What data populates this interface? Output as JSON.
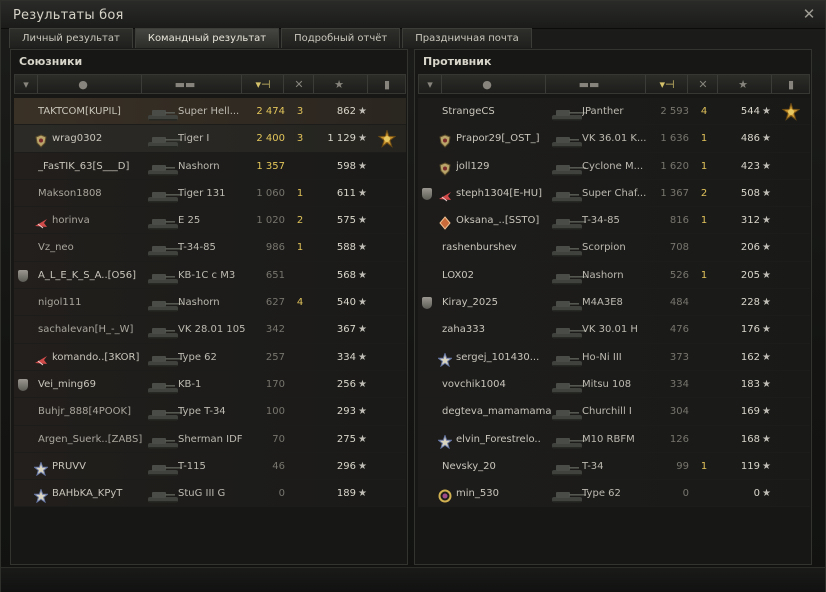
{
  "window": {
    "title": "Результаты боя"
  },
  "tabs": [
    {
      "label": "Личный результат"
    },
    {
      "label": "Командный результат"
    },
    {
      "label": "Подробный отчёт"
    },
    {
      "label": "Праздничная почта"
    }
  ],
  "allies": {
    "title": "Союзники",
    "rows": [
      {
        "name": "TAKTCOM[KUPIL]",
        "vehicle": "Super Hell...",
        "damage": "2 474",
        "kills": "3",
        "xp": "862"
      },
      {
        "name": "wrag0302",
        "vehicle": "Tiger I",
        "damage": "2 400",
        "kills": "3",
        "xp": "1 129"
      },
      {
        "name": "_FasTIK_63[S___D]",
        "vehicle": "Nashorn",
        "damage": "1 357",
        "kills": "",
        "xp": "598"
      },
      {
        "name": "Makson1808",
        "vehicle": "Tiger 131",
        "damage": "1 060",
        "kills": "1",
        "xp": "611"
      },
      {
        "name": "horinva",
        "vehicle": "E 25",
        "damage": "1 020",
        "kills": "2",
        "xp": "575"
      },
      {
        "name": "Vz_neo",
        "vehicle": "T-34-85",
        "damage": "986",
        "kills": "1",
        "xp": "588"
      },
      {
        "name": "A_L_E_K_S_A..[O56]",
        "vehicle": "KB-1C с M3",
        "damage": "651",
        "kills": "",
        "xp": "568"
      },
      {
        "name": "nigol111",
        "vehicle": "Nashorn",
        "damage": "627",
        "kills": "4",
        "xp": "540"
      },
      {
        "name": "sachalevan[H_-_W]",
        "vehicle": "VK 28.01 105",
        "damage": "342",
        "kills": "",
        "xp": "367"
      },
      {
        "name": "komando..[3KOR]",
        "vehicle": "Type 62",
        "damage": "257",
        "kills": "",
        "xp": "334"
      },
      {
        "name": "Vei_ming69",
        "vehicle": "KB-1",
        "damage": "170",
        "kills": "",
        "xp": "256"
      },
      {
        "name": "Buhjr_888[4POOK]",
        "vehicle": "Type T-34",
        "damage": "100",
        "kills": "",
        "xp": "293"
      },
      {
        "name": "Argen_Suerk..[ZABS]",
        "vehicle": "Sherman IDF",
        "damage": "70",
        "kills": "",
        "xp": "275"
      },
      {
        "name": "PRUVV",
        "vehicle": "T-115",
        "damage": "46",
        "kills": "",
        "xp": "296"
      },
      {
        "name": "BAHbKA_KPyT",
        "vehicle": "StuG III G",
        "damage": "0",
        "kills": "",
        "xp": "189"
      }
    ]
  },
  "enemies": {
    "title": "Противник",
    "rows": [
      {
        "name": "StrangeCS",
        "vehicle": "JPanther",
        "damage": "2 593",
        "kills": "4",
        "xp": "544"
      },
      {
        "name": "Prapor29[_OST_]",
        "vehicle": "VK 36.01 K...",
        "damage": "1 636",
        "kills": "1",
        "xp": "486"
      },
      {
        "name": "joll129",
        "vehicle": "Cyclone M...",
        "damage": "1 620",
        "kills": "1",
        "xp": "423"
      },
      {
        "name": "steph1304[E-HU]",
        "vehicle": "Super Chaf...",
        "damage": "1 367",
        "kills": "2",
        "xp": "508"
      },
      {
        "name": "Oksana_..[SSTO]",
        "vehicle": "T-34-85",
        "damage": "816",
        "kills": "1",
        "xp": "312"
      },
      {
        "name": "rashenburshev",
        "vehicle": "Scorpion",
        "damage": "708",
        "kills": "",
        "xp": "206"
      },
      {
        "name": "LOX02",
        "vehicle": "Nashorn",
        "damage": "526",
        "kills": "1",
        "xp": "205"
      },
      {
        "name": "Kiray_2025",
        "vehicle": "M4A3E8",
        "damage": "484",
        "kills": "",
        "xp": "228"
      },
      {
        "name": "zaha333",
        "vehicle": "VK 30.01 H",
        "damage": "476",
        "kills": "",
        "xp": "176"
      },
      {
        "name": "sergej_101430...",
        "vehicle": "Ho-Ni III",
        "damage": "373",
        "kills": "",
        "xp": "162"
      },
      {
        "name": "vovchik1004",
        "vehicle": "Mitsu 108",
        "damage": "334",
        "kills": "",
        "xp": "183"
      },
      {
        "name": "degteva_mamamama",
        "vehicle": "Churchill I",
        "damage": "304",
        "kills": "",
        "xp": "169"
      },
      {
        "name": "elvin_Forestrelo..",
        "vehicle": "M10 RBFM",
        "damage": "126",
        "kills": "",
        "xp": "168"
      },
      {
        "name": "Nevsky_20",
        "vehicle": "T-34",
        "damage": "99",
        "kills": "1",
        "xp": "119"
      },
      {
        "name": "min_530",
        "vehicle": "Type 62",
        "damage": "0",
        "kills": "",
        "xp": "0"
      }
    ]
  }
}
